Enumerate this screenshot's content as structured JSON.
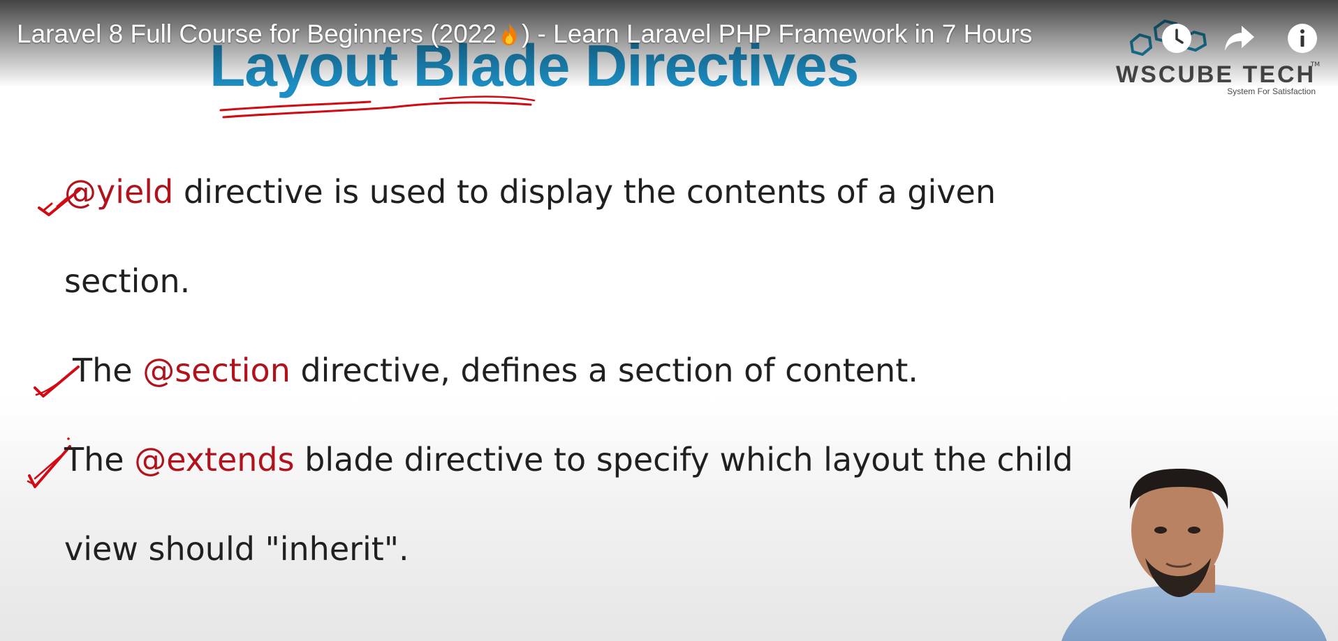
{
  "video": {
    "title_part1": "Laravel 8 Full Course for Beginners (2022",
    "title_emoji": "fire-emoji",
    "title_part2": ") - Learn Laravel PHP Framework in 7 Hours"
  },
  "controls": {
    "watch_later": "clock-icon",
    "share": "share-arrow-icon",
    "info": "info-icon"
  },
  "slide": {
    "title": "Layout Blade Directives",
    "items": [
      {
        "prefix": "",
        "keyword": "@yield",
        "rest": " directive is used to display the contents of a given",
        "continuation": "section."
      },
      {
        "prefix": "The ",
        "keyword": "@section",
        "rest": " directive, defines a section of content."
      },
      {
        "prefix": "The ",
        "keyword": "@extends",
        "rest": " blade directive to specify which layout the child",
        "continuation": "view should \"inherit\"."
      }
    ]
  },
  "logo": {
    "wordmark": "WSCUBE TECH",
    "tm": "TM",
    "tagline": "System For Satisfaction"
  },
  "colors": {
    "title_blue": "#1d8fc4",
    "keyword_red": "#b1121b",
    "ink_red": "#d10a14",
    "logo_teal": "#1e8fb8"
  }
}
